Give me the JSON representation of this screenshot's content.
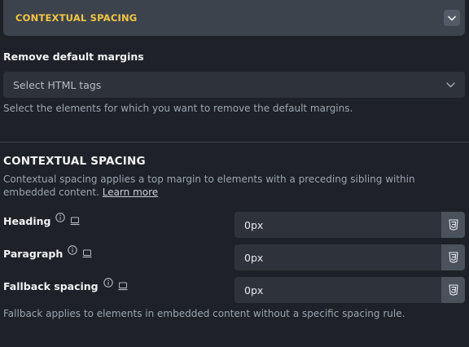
{
  "header": {
    "title": "CONTEXTUAL SPACING",
    "collapse_icon": "chevron-down-icon"
  },
  "remove_margins": {
    "label": "Remove default margins",
    "select": {
      "placeholder": "Select HTML tags",
      "icon": "chevron-down-icon"
    },
    "help": "Select the elements for which you want to remove the default margins."
  },
  "contextual": {
    "title": "CONTEXTUAL SPACING",
    "description": "Contextual spacing applies a top margin to elements with a preceding sibling within embedded content.",
    "learn_more": "Learn more",
    "rows": [
      {
        "label": "Heading",
        "value": "0px",
        "unit_icon": "css3-icon"
      },
      {
        "label": "Paragraph",
        "value": "0px",
        "unit_icon": "css3-icon"
      },
      {
        "label": "Fallback spacing",
        "value": "0px",
        "unit_icon": "css3-icon"
      }
    ],
    "fallback_help": "Fallback applies to elements in embedded content without a specific spacing rule."
  },
  "colors": {
    "accent": "#f4c542",
    "background": "#1e2127",
    "input_bg": "#2e333b"
  }
}
